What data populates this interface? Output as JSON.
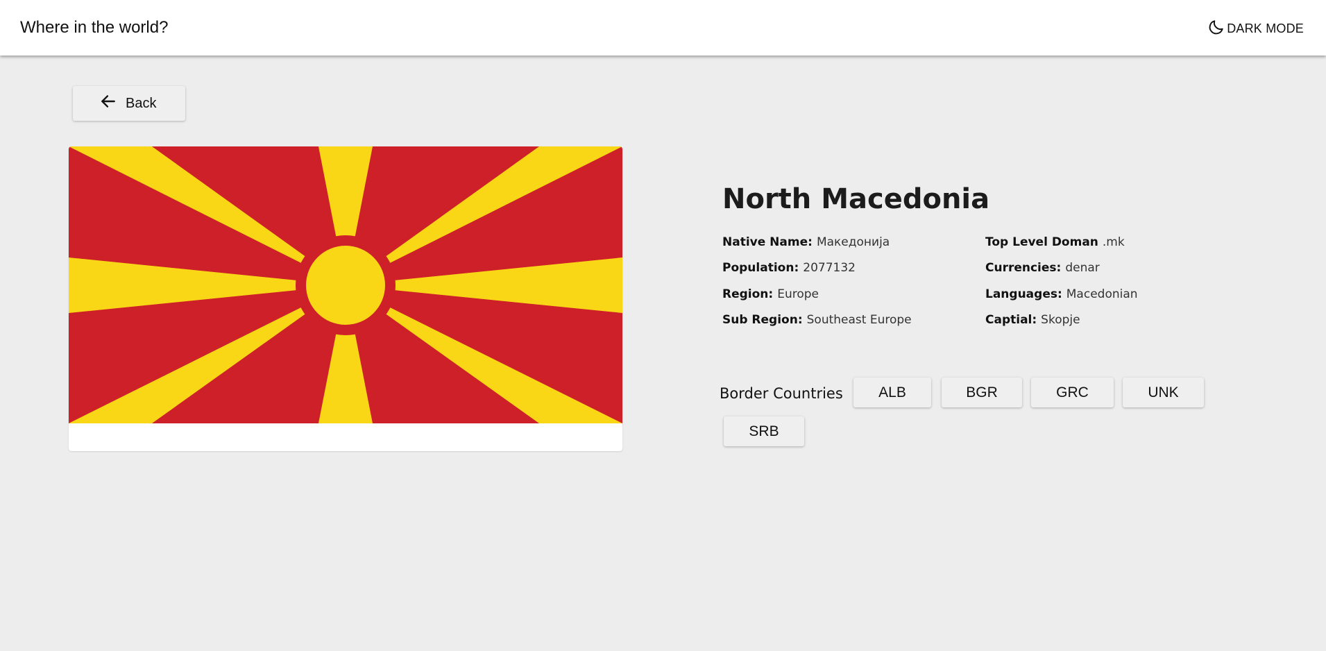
{
  "header": {
    "title": "Where in the world?",
    "theme_toggle_label": "DARK MODE",
    "theme_icon": "moon-icon"
  },
  "back_button": {
    "label": "Back",
    "icon": "arrow-left-icon"
  },
  "flag": {
    "description_icon": "north-macedonia-flag",
    "colors": {
      "field": "#CE2028",
      "sun": "#F9D616"
    }
  },
  "country": {
    "name": "North Macedonia",
    "facts_left": [
      {
        "label": "Native Name:",
        "value": "Македонија"
      },
      {
        "label": "Population:",
        "value": "2077132"
      },
      {
        "label": "Region:",
        "value": "Europe"
      },
      {
        "label": "Sub Region:",
        "value": "Southeast Europe"
      }
    ],
    "facts_right": [
      {
        "label": "Top Level Doman",
        "value": ".mk"
      },
      {
        "label": "Currencies:",
        "value": "denar"
      },
      {
        "label": "Languages:",
        "value": "Macedonian"
      },
      {
        "label": "Captial:",
        "value": "Skopje"
      }
    ]
  },
  "borders": {
    "label": "Border Countries",
    "countries": [
      "ALB",
      "BGR",
      "GRC",
      "UNK",
      "SRB"
    ]
  }
}
